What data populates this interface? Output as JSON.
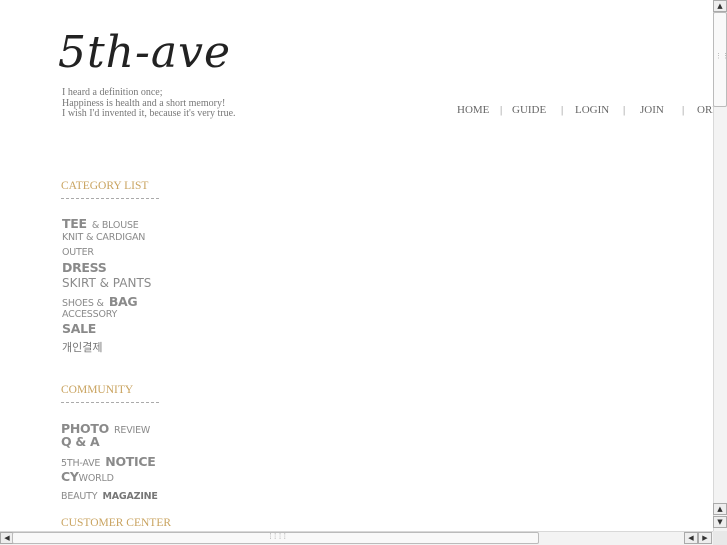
{
  "logo": {
    "text": "5th-ave"
  },
  "quote": {
    "line1": "I heard a definition once;",
    "line2": "Happiness is health and a short memory!",
    "line3": "I wish I'd invented it, because it's very true."
  },
  "topnav": {
    "home": "HOME",
    "guide": "GUIDE",
    "login": "LOGIN",
    "join": "JOIN",
    "order": "ORDER",
    "separator": "|"
  },
  "category": {
    "title": "CATEGORY LIST",
    "tee": "TEE",
    "blouse": "& BLOUSE",
    "knit": "KNIT & CARDIGAN",
    "outer": "OUTER",
    "dress": "DRESS",
    "skirt": "SKIRT & PANTS",
    "shoes": "SHOES &",
    "bag": "BAG",
    "accessory": "ACCESSORY",
    "sale": "SALE",
    "payment": "개인결제"
  },
  "community": {
    "title": "COMMUNITY",
    "photo": "PHOTO",
    "review": "REVIEW",
    "qa": "Q & A",
    "fifth": "5TH-AVE",
    "notice": "NOTICE",
    "cy": "CY",
    "world": "WORLD",
    "beauty": "BEAUTY",
    "magazine": "MAGAZINE"
  },
  "customer": {
    "title": "CUSTOMER CENTER"
  },
  "scroll": {
    "up": "▲",
    "down": "▼",
    "left": "◀",
    "right": "▶",
    "grip_h": "⁞⁞⁞⁞",
    "grip_v": "⋮⋮"
  }
}
